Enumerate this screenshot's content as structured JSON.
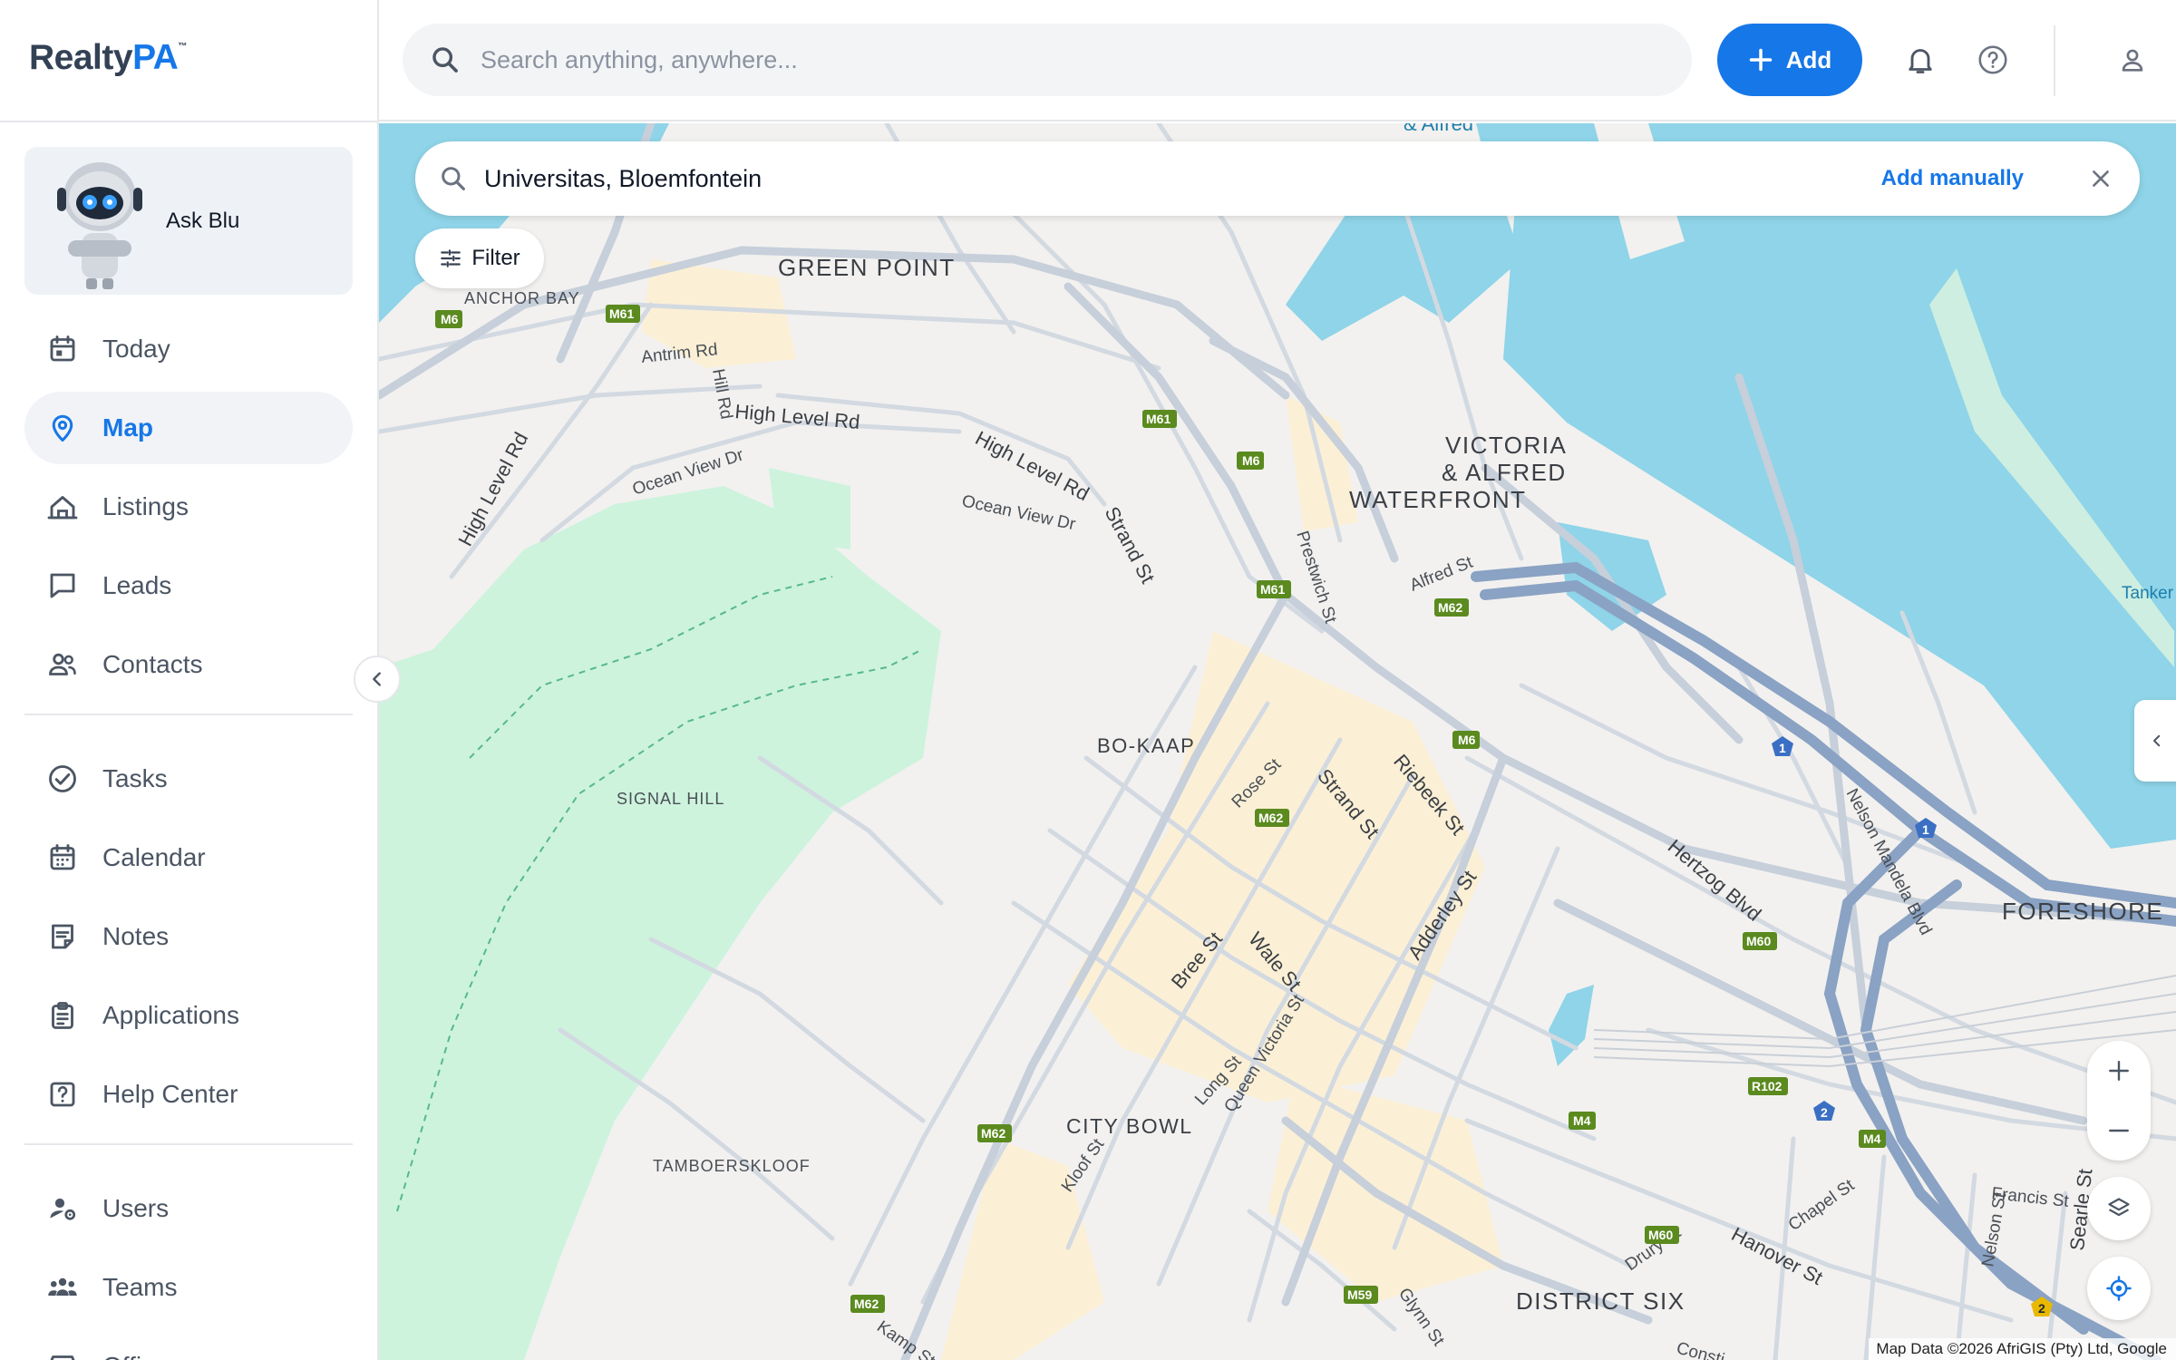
{
  "app": {
    "logo_main": "Realty",
    "logo_accent": "PA",
    "logo_mark": "™"
  },
  "topbar": {
    "search_placeholder": "Search anything, anywhere...",
    "add_label": "Add"
  },
  "sidebar": {
    "ask_blu": "Ask Blu",
    "groups": [
      [
        {
          "label": "Today",
          "icon": "calendar-today-icon",
          "active": false
        },
        {
          "label": "Map",
          "icon": "map-pin-icon",
          "active": true
        },
        {
          "label": "Listings",
          "icon": "listings-house-icon",
          "active": false
        },
        {
          "label": "Leads",
          "icon": "chat-bubble-icon",
          "active": false
        },
        {
          "label": "Contacts",
          "icon": "contacts-icon",
          "active": false
        }
      ],
      [
        {
          "label": "Tasks",
          "icon": "check-circle-icon",
          "active": false
        },
        {
          "label": "Calendar",
          "icon": "calendar-icon",
          "active": false
        },
        {
          "label": "Notes",
          "icon": "notes-icon",
          "active": false
        },
        {
          "label": "Applications",
          "icon": "clipboard-icon",
          "active": false
        },
        {
          "label": "Help Center",
          "icon": "help-square-icon",
          "active": false
        }
      ],
      [
        {
          "label": "Users",
          "icon": "user-gear-icon",
          "active": false
        },
        {
          "label": "Teams",
          "icon": "teams-icon",
          "active": false
        },
        {
          "label": "Offices",
          "icon": "offices-icon",
          "active": false
        }
      ]
    ]
  },
  "map": {
    "search_value": "Universitas, Bloemfontein",
    "add_manually": "Add manually",
    "filter_label": "Filter",
    "attribution": "Map Data ©2026 AfriGIS (Pty) Ltd, Google",
    "area_labels": {
      "green_point": "GREEN POINT",
      "anchor_bay": "ANCHOR BAY",
      "va_line1": "VICTORIA",
      "va_line2": "& ALFRED",
      "va_line3": "WATERFRONT",
      "va_top": "& Alfred",
      "bo_kaap": "BO-KAAP",
      "signal_hill": "SIGNAL HILL",
      "city_bowl": "CITY BOWL",
      "tamboerskloof": "TAMBOERSKLOOF",
      "district_six": "DISTRICT SIX",
      "foreshore": "FORESHORE",
      "tanker": "Tanker B"
    },
    "road_labels": {
      "antrim": "Antrim Rd",
      "hill": "Hill Rd",
      "high_level_1": "High Level Rd",
      "high_level_2": "High Level Rd",
      "high_level_3": "High Level Rd",
      "ocean_view_1": "Ocean View Dr",
      "ocean_view_2": "Ocean View Dr",
      "strand_1": "Strand St",
      "strand_2": "Strand St",
      "prestwich": "Prestwich St",
      "alfred": "Alfred St",
      "rose": "Rose St",
      "riebeek": "Riebeek St",
      "adderley": "Adderley St",
      "bree": "Bree St",
      "wale": "Wale St",
      "long": "Long St",
      "queen_victoria": "Queen Victoria St",
      "kloof": "Kloof St",
      "hertzog": "Hertzog Blvd",
      "nelson_mandela": "Nelson Mandela Blvd",
      "hanover": "Hanover St",
      "chapel": "Chapel St",
      "drury": "Drury St",
      "francis": "Francis St",
      "nelson": "Nelson St",
      "searle": "Searle St",
      "glynn": "Glynn St",
      "kamp": "Kamp St",
      "constitution": "Consti"
    },
    "shields": {
      "m6_a": "M6",
      "m61_a": "M61",
      "m61_b": "M61",
      "m6_b": "M6",
      "m61_c": "M61",
      "m62_a": "M62",
      "m6_c": "M6",
      "m62_b": "M62",
      "m62_c": "M62",
      "m62_d": "M62",
      "m60_a": "M60",
      "r102": "R102",
      "m4_a": "M4",
      "m4_b": "M4",
      "m60_b": "M60",
      "m59": "M59",
      "n1_a": "1",
      "n1_b": "1",
      "n2_a": "2",
      "n2_b": "2"
    },
    "colors": {
      "water": "#8fd4e8",
      "park": "#cdf3dd",
      "land": "#f2f1ef",
      "highway": "#8aa2c3",
      "road": "#d3d9e1",
      "commercial": "#fbf0d6",
      "shield_regional": "#5b8a1f",
      "shield_national": "#3a6fc4"
    }
  }
}
